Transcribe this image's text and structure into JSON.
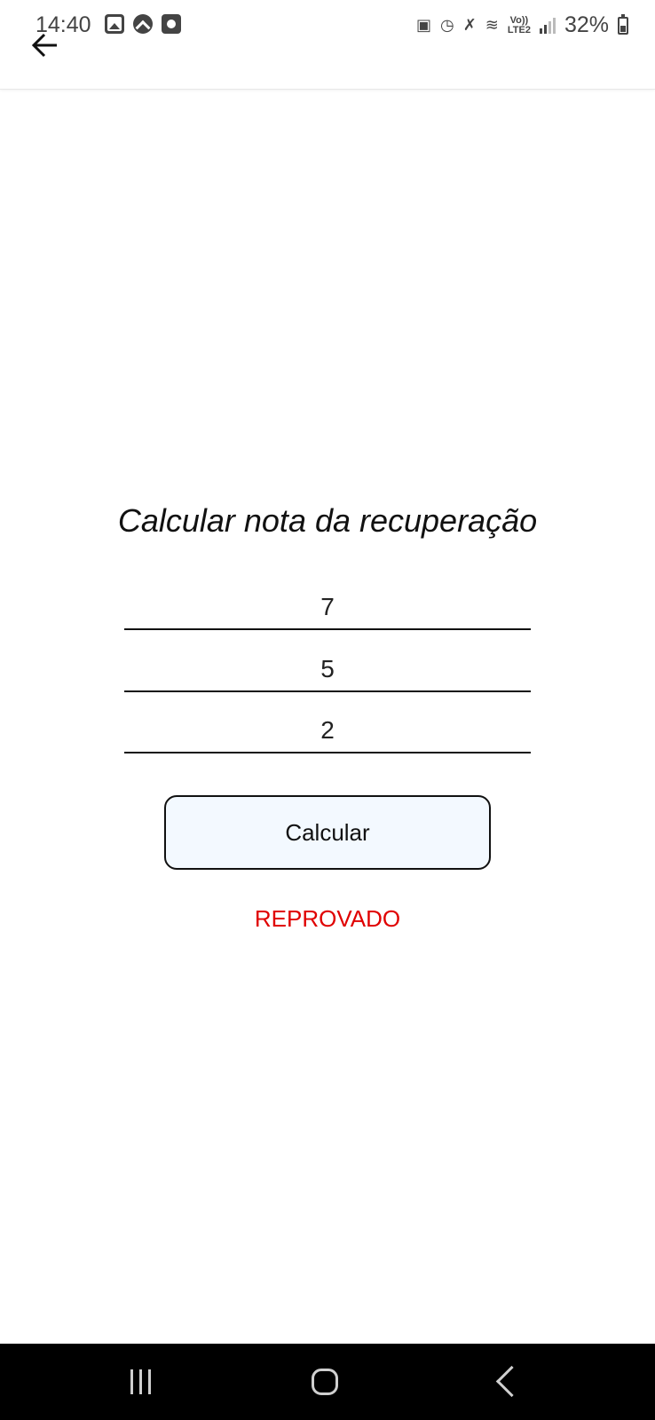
{
  "status_bar": {
    "time": "14:40",
    "battery": "32%",
    "network": "LTE2",
    "volte": "Vo))",
    "left_icons": [
      "gallery-icon",
      "app-caret-icon",
      "record-icon"
    ],
    "right_icons": [
      "lock-icon",
      "alarm-icon",
      "mute-icon",
      "wifi-icon",
      "signal-icon",
      "battery-icon"
    ]
  },
  "header": {
    "back_icon": "back-arrow-icon"
  },
  "main": {
    "title": "Calcular nota da recuperação",
    "inputs": [
      {
        "value": "7"
      },
      {
        "value": "5"
      },
      {
        "value": "2"
      }
    ],
    "button_label": "Calcular",
    "result": "REPROVADO",
    "result_color": "#e00000",
    "button_bg": "#f3f9ff"
  },
  "nav_bar": {
    "icons": [
      "recents-icon",
      "home-icon",
      "back-icon"
    ]
  }
}
